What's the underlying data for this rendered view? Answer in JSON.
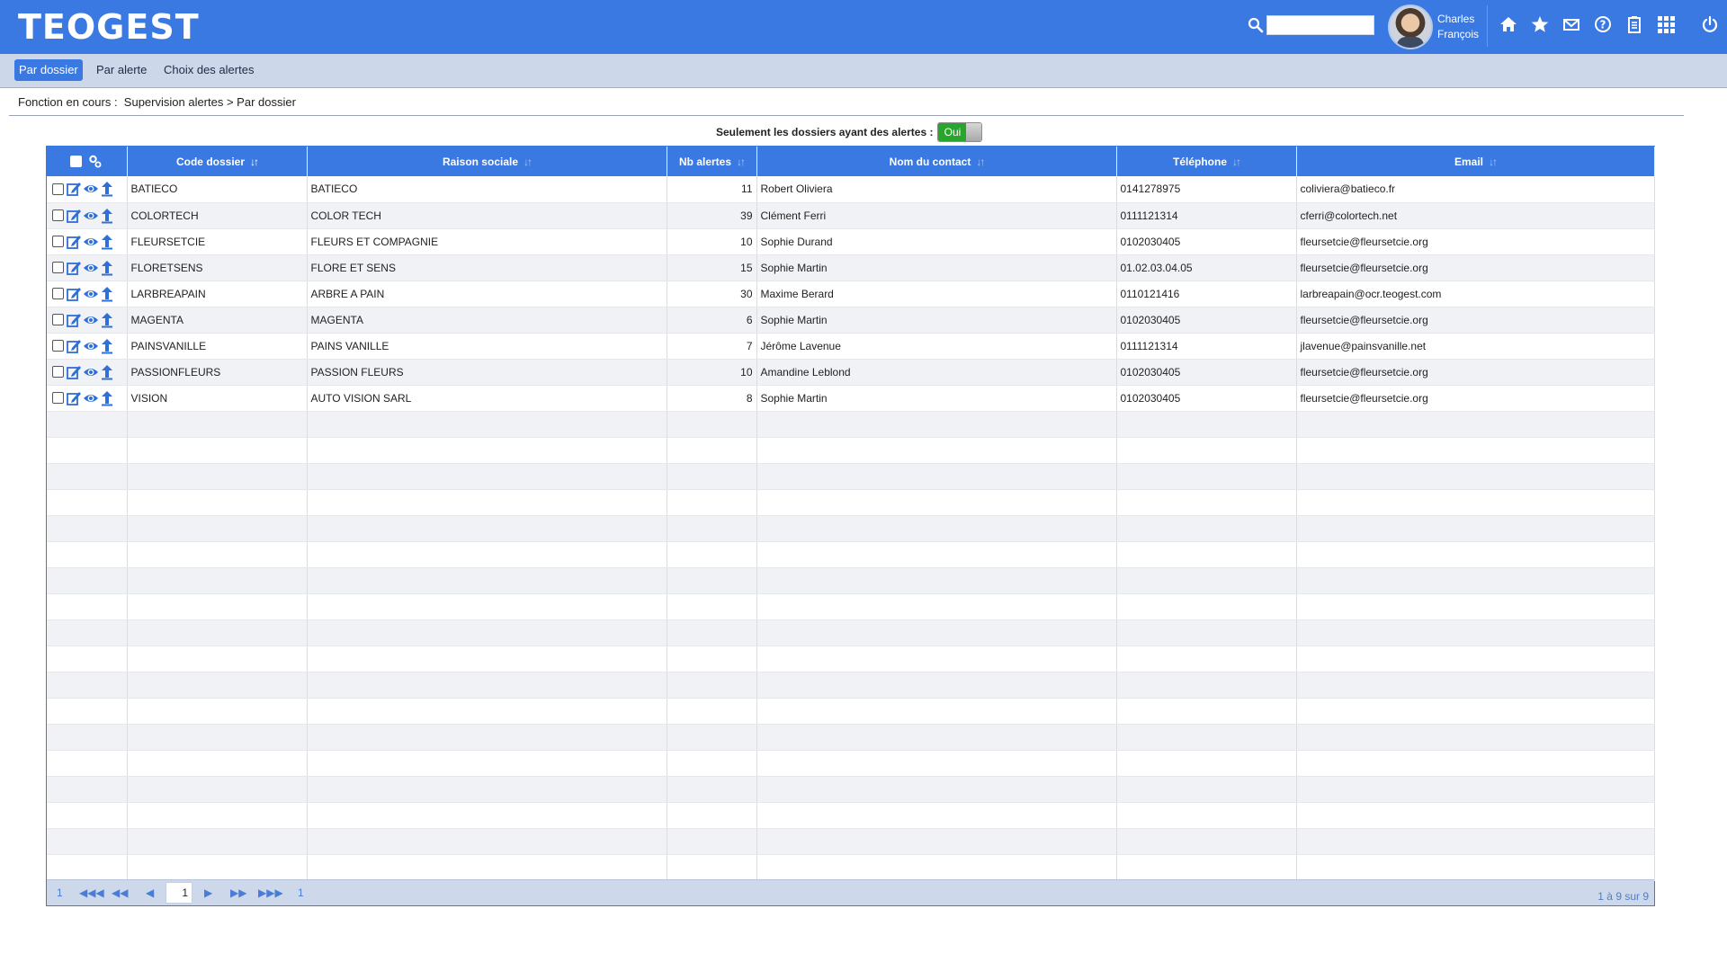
{
  "app": {
    "logo": "TEOGEST"
  },
  "header": {
    "search": {
      "value": "",
      "placeholder": ""
    },
    "user": {
      "first_name": "Charles",
      "last_name": "François"
    },
    "icons": [
      "home-icon",
      "star-icon",
      "mail-icon",
      "help-icon",
      "clipboard-icon",
      "apps-grid-icon",
      "power-icon"
    ]
  },
  "tabs": [
    {
      "label": "Par dossier",
      "active": true
    },
    {
      "label": "Par alerte",
      "active": false
    },
    {
      "label": "Choix des alertes",
      "active": false
    }
  ],
  "breadcrumb": {
    "prefix": "Fonction en cours :",
    "path": "Supervision alertes > Par dossier"
  },
  "filter": {
    "label": "Seulement les dossiers ayant des alertes :",
    "toggle_label": "Oui",
    "toggle_on": true
  },
  "columns": [
    "Code dossier",
    "Raison sociale",
    "Nb alertes",
    "Nom du contact",
    "Téléphone",
    "Email"
  ],
  "rows": [
    {
      "code": "BATIECO",
      "raison": "BATIECO",
      "nb": "11",
      "contact": "Robert Oliviera",
      "tel": "0141278975",
      "email": "coliviera@batieco.fr"
    },
    {
      "code": "COLORTECH",
      "raison": "COLOR TECH",
      "nb": "39",
      "contact": "Clément Ferri",
      "tel": "0111121314",
      "email": "cferri@colortech.net"
    },
    {
      "code": "FLEURSETCIE",
      "raison": "FLEURS ET COMPAGNIE",
      "nb": "10",
      "contact": "Sophie Durand",
      "tel": "0102030405",
      "email": "fleursetcie@fleursetcie.org"
    },
    {
      "code": "FLORETSENS",
      "raison": "FLORE ET SENS",
      "nb": "15",
      "contact": "Sophie Martin",
      "tel": "01.02.03.04.05",
      "email": "fleursetcie@fleursetcie.org"
    },
    {
      "code": "LARBREAPAIN",
      "raison": "ARBRE A PAIN",
      "nb": "30",
      "contact": "Maxime Berard",
      "tel": "0110121416",
      "email": "larbreapain@ocr.teogest.com"
    },
    {
      "code": "MAGENTA",
      "raison": "MAGENTA",
      "nb": "6",
      "contact": "Sophie Martin",
      "tel": "0102030405",
      "email": "fleursetcie@fleursetcie.org"
    },
    {
      "code": "PAINSVANILLE",
      "raison": "PAINS VANILLE",
      "nb": "7",
      "contact": "Jérôme Lavenue",
      "tel": "0111121314",
      "email": "jlavenue@painsvanille.net"
    },
    {
      "code": "PASSIONFLEURS",
      "raison": "PASSION FLEURS",
      "nb": "10",
      "contact": "Amandine Leblond",
      "tel": "0102030405",
      "email": "fleursetcie@fleursetcie.org"
    },
    {
      "code": "VISION",
      "raison": "AUTO VISION SARL",
      "nb": "8",
      "contact": "Sophie Martin",
      "tel": "0102030405",
      "email": "fleursetcie@fleursetcie.org"
    }
  ],
  "empty_rows": 18,
  "pager": {
    "first_label": "1",
    "current_page": "1",
    "last_label": "1",
    "count_text": "1 à 9 sur 9"
  },
  "colors": {
    "primary": "#3a78e2",
    "tabbar": "#ccd7ea",
    "toggle_on": "#27a52c"
  }
}
